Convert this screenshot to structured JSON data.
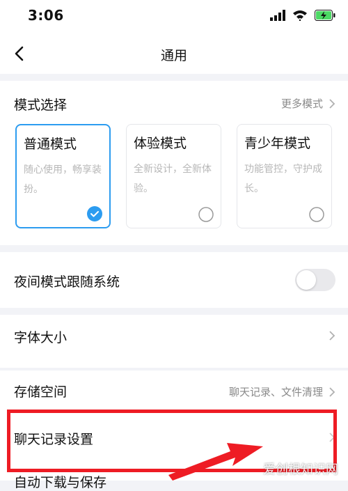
{
  "status": {
    "time": "3:06"
  },
  "nav": {
    "title": "通用"
  },
  "mode_section": {
    "title": "模式选择",
    "more_label": "更多模式",
    "modes": [
      {
        "title": "普通模式",
        "desc": "随心使用，畅享装扮。",
        "selected": true
      },
      {
        "title": "体验模式",
        "desc": "全新设计，全新体验。",
        "selected": false
      },
      {
        "title": "青少年模式",
        "desc": "功能管控，守护成长。",
        "selected": false
      }
    ]
  },
  "night_mode": {
    "label": "夜间模式跟随系统",
    "enabled": false
  },
  "font_size": {
    "label": "字体大小"
  },
  "storage": {
    "label": "存储空间",
    "detail": "聊天记录、文件清理"
  },
  "chat_history": {
    "label": "聊天记录设置"
  },
  "auto_download": {
    "label": "自动下载与保存"
  },
  "watermark": "爱创根知识网",
  "colors": {
    "accent": "#2c9cf0",
    "highlight": "#ee1c24",
    "background": "#f2f3f7"
  }
}
